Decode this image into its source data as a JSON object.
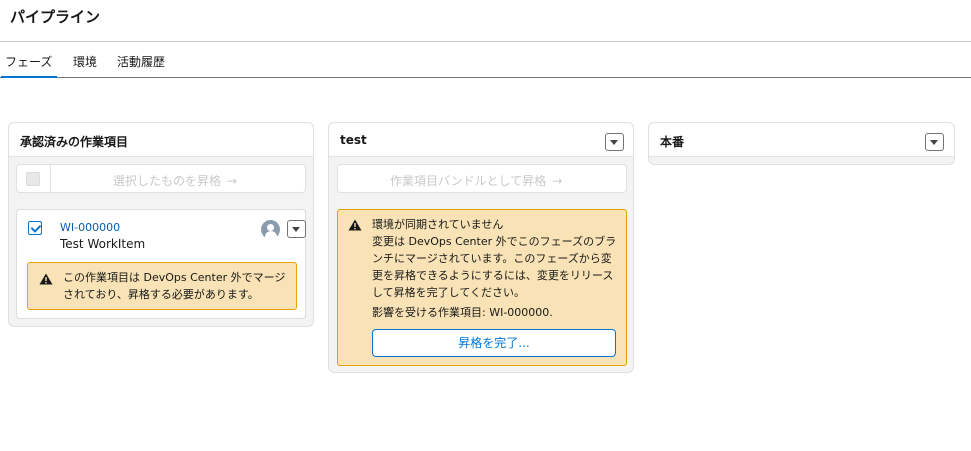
{
  "page": {
    "title": "パイプライン"
  },
  "tabs": [
    {
      "label": "フェーズ",
      "active": true
    },
    {
      "label": "環境",
      "active": false
    },
    {
      "label": "活動履歴",
      "active": false
    }
  ],
  "columns": {
    "approved": {
      "title": "承認済みの作業項目",
      "promote_selected_label": "選択したものを昇格",
      "arrow": "→",
      "work_item": {
        "id": "WI-000000",
        "title": "Test WorkItem",
        "checked": true,
        "warning": "この作業項目は DevOps Center 外でマージされており、昇格する必要があります。"
      }
    },
    "test": {
      "title": "test",
      "promote_bundle_label": "作業項目バンドルとして昇格",
      "arrow": "→",
      "warning": {
        "title": "環境が同期されていません",
        "body": "変更は DevOps Center 外でこのフェーズのブランチにマージされています。このフェーズから変更を昇格できるようにするには、変更をリリースして昇格を完了してください。",
        "affected": "影響を受ける作業項目: WI-000000.",
        "button_label": "昇格を完了..."
      }
    },
    "production": {
      "title": "本番"
    }
  },
  "colors": {
    "accent": "#0176d3",
    "warning_bg": "#f9e3b6",
    "warning_border": "#e4a201",
    "column_bg": "#f3f3f3"
  },
  "icons": [
    "chevron-down-icon",
    "warning-icon",
    "user-avatar-icon",
    "arrow-right-icon",
    "checkbox-checked-icon"
  ]
}
